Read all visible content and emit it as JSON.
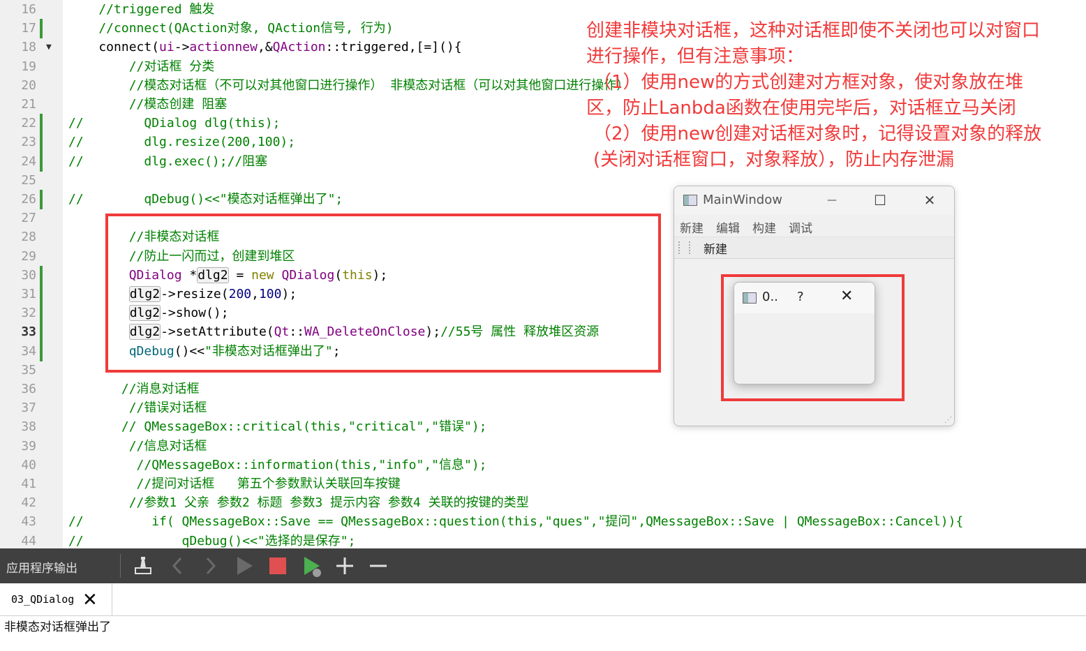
{
  "editor": {
    "lines": [
      {
        "n": "16",
        "segs": [
          {
            "t": "    //triggered 触发",
            "c": "cmt"
          }
        ]
      },
      {
        "n": "17",
        "mark": true,
        "segs": [
          {
            "t": "    //connect(QAction对象, QAction信号, 行为)",
            "c": "cmt"
          }
        ]
      },
      {
        "n": "18",
        "fold": true,
        "segs": [
          {
            "t": "    connect(",
            "c": ""
          },
          {
            "t": "ui",
            "c": "typ"
          },
          {
            "t": "->",
            "c": ""
          },
          {
            "t": "actionnew",
            "c": "typ"
          },
          {
            "t": ",&",
            "c": ""
          },
          {
            "t": "QAction",
            "c": "typ"
          },
          {
            "t": "::triggered,[=](){",
            "c": ""
          }
        ]
      },
      {
        "n": "19",
        "segs": [
          {
            "t": "        //对话框 分类",
            "c": "cmt"
          }
        ]
      },
      {
        "n": "20",
        "segs": [
          {
            "t": "        //模态对话框（不可以对其他窗口进行操作） 非模态对话框（可以对其他窗口进行操作）",
            "c": "cmt"
          }
        ]
      },
      {
        "n": "21",
        "segs": [
          {
            "t": "        //模态创建 阻塞",
            "c": "cmt"
          }
        ]
      },
      {
        "n": "22",
        "mark": true,
        "segs": [
          {
            "t": "//        QDialog dlg(this);",
            "c": "cmt"
          }
        ]
      },
      {
        "n": "23",
        "mark": true,
        "segs": [
          {
            "t": "//        dlg.resize(200,100);",
            "c": "cmt"
          }
        ]
      },
      {
        "n": "24",
        "mark": true,
        "segs": [
          {
            "t": "//        dlg.exec();//阻塞",
            "c": "cmt"
          }
        ]
      },
      {
        "n": "25",
        "segs": []
      },
      {
        "n": "26",
        "mark": true,
        "segs": [
          {
            "t": "//        qDebug()<<\"模态对话框弹出了\";",
            "c": "cmt"
          }
        ]
      },
      {
        "n": "27",
        "segs": []
      },
      {
        "n": "28",
        "segs": [
          {
            "t": "        //非模态对话框",
            "c": "cmt"
          }
        ]
      },
      {
        "n": "29",
        "segs": [
          {
            "t": "        //防止一闪而过，创建到堆区",
            "c": "cmt"
          }
        ]
      },
      {
        "n": "30",
        "mark": true,
        "segs": [
          {
            "t": "        ",
            "c": ""
          },
          {
            "t": "QDialog",
            "c": "typ"
          },
          {
            "t": " *",
            "c": ""
          },
          {
            "t": "dlg2",
            "c": "hl"
          },
          {
            "t": " = ",
            "c": ""
          },
          {
            "t": "new",
            "c": "kw"
          },
          {
            "t": " ",
            "c": ""
          },
          {
            "t": "QDialog",
            "c": "typ"
          },
          {
            "t": "(",
            "c": ""
          },
          {
            "t": "this",
            "c": "kw"
          },
          {
            "t": ");",
            "c": ""
          }
        ]
      },
      {
        "n": "31",
        "mark": true,
        "segs": [
          {
            "t": "        ",
            "c": ""
          },
          {
            "t": "dlg2",
            "c": "hl"
          },
          {
            "t": "->resize(",
            "c": ""
          },
          {
            "t": "200",
            "c": "num"
          },
          {
            "t": ",",
            "c": ""
          },
          {
            "t": "100",
            "c": "num"
          },
          {
            "t": ");",
            "c": ""
          }
        ]
      },
      {
        "n": "32",
        "mark": true,
        "segs": [
          {
            "t": "        ",
            "c": ""
          },
          {
            "t": "dlg2",
            "c": "hl"
          },
          {
            "t": "->show();",
            "c": ""
          }
        ]
      },
      {
        "n": "33",
        "mark": true,
        "cur": true,
        "segs": [
          {
            "t": "        ",
            "c": ""
          },
          {
            "t": "dlg2",
            "c": "hl"
          },
          {
            "t": "->setAttribute(",
            "c": ""
          },
          {
            "t": "Qt",
            "c": "typ"
          },
          {
            "t": "::",
            "c": ""
          },
          {
            "t": "WA_DeleteOnClose",
            "c": "typ"
          },
          {
            "t": ");",
            "c": ""
          },
          {
            "t": "//55号 属性 释放堆区资源",
            "c": "cmt"
          }
        ]
      },
      {
        "n": "34",
        "mark": true,
        "segs": [
          {
            "t": "        ",
            "c": ""
          },
          {
            "t": "qDebug",
            "c": "fn"
          },
          {
            "t": "()<<",
            "c": ""
          },
          {
            "t": "\"非模态对话框弹出了\"",
            "c": "str"
          },
          {
            "t": ";",
            "c": ""
          }
        ]
      },
      {
        "n": "35",
        "segs": []
      },
      {
        "n": "36",
        "segs": [
          {
            "t": "       //消息对话框",
            "c": "cmt"
          }
        ]
      },
      {
        "n": "37",
        "segs": [
          {
            "t": "        //错误对话框",
            "c": "cmt"
          }
        ]
      },
      {
        "n": "38",
        "segs": [
          {
            "t": "       // QMessageBox::critical(this,\"critical\",\"错误\");",
            "c": "cmt"
          }
        ]
      },
      {
        "n": "39",
        "segs": [
          {
            "t": "        //信息对话框",
            "c": "cmt"
          }
        ]
      },
      {
        "n": "40",
        "segs": [
          {
            "t": "         //QMessageBox::information(this,\"info\",\"信息\");",
            "c": "cmt"
          }
        ]
      },
      {
        "n": "41",
        "segs": [
          {
            "t": "         //提问对话框   第五个参数默认关联回车按键",
            "c": "cmt"
          }
        ]
      },
      {
        "n": "42",
        "segs": [
          {
            "t": "        //参数1 父亲 参数2 标题 参数3 提示内容 参数4 关联的按键的类型",
            "c": "cmt"
          }
        ]
      },
      {
        "n": "43",
        "segs": [
          {
            "t": "//         if( QMessageBox::Save == QMessageBox::question(this,\"ques\",\"提问\",QMessageBox::Save | QMessageBox::Cancel)){",
            "c": "cmt"
          }
        ]
      },
      {
        "n": "44",
        "segs": [
          {
            "t": "//             qDebug()<<\"选择的是保存\";",
            "c": "cmt"
          }
        ]
      }
    ]
  },
  "annotation": {
    "lines": [
      "创建非模块对话框，这种对话框即使不关闭也可以对窗口",
      "进行操作，但有注意事项：",
      "（1）使用new的方式创建对方框对象，使对象放在堆",
      "区，防止Lanbda函数在使用完毕后，对话框立马关闭",
      "（2）使用new创建对话框对象时，记得设置对象的释放",
      "(关闭对话框窗口，对象释放），防止内存泄漏"
    ],
    "color": "#f03a3a"
  },
  "mainwindow": {
    "title": "MainWindow",
    "minimize": "—",
    "maximize": "☐",
    "close": "✕",
    "menu": [
      "新建",
      "编辑",
      "构建",
      "调试"
    ],
    "toolbar_action": "新建",
    "grip": "⋰"
  },
  "dialog": {
    "title": "0..",
    "help": "?",
    "close": "✕"
  },
  "output_pane": {
    "title": "应用程序输出",
    "tab_label": "03_QDialog",
    "tab_close": "✕",
    "text": "非模态对话框弹出了"
  }
}
